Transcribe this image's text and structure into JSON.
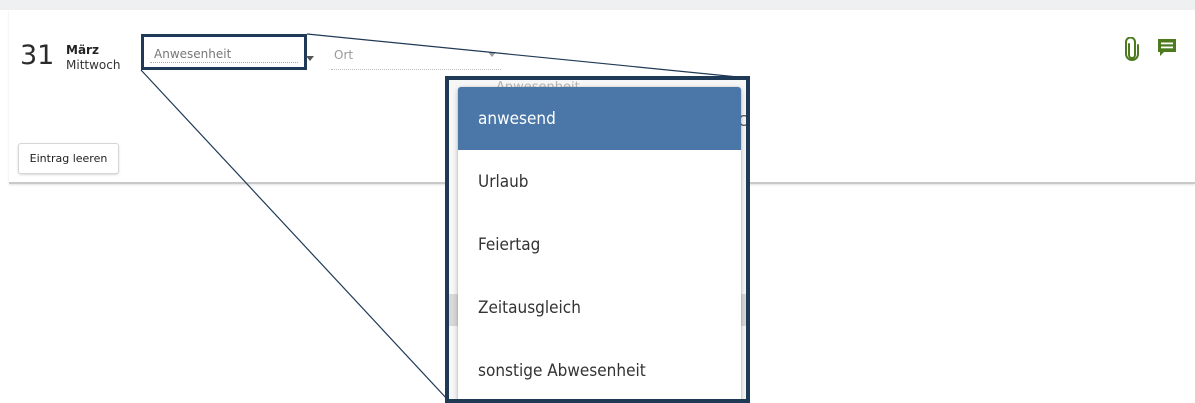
{
  "entry": {
    "day": "31",
    "month": "März",
    "weekday": "Mittwoch"
  },
  "fields": {
    "attendance_value": "Anwesenheit",
    "location_placeholder": "Ort"
  },
  "buttons": {
    "clear_entry": "Eintrag leeren"
  },
  "icons": {
    "attachment": "paperclip-icon",
    "comment": "comment-icon",
    "accent_color": "#4d7a1f"
  },
  "zoom": {
    "ghost_label": "Anwesenheit",
    "ghost_letter": "O"
  },
  "dropdown": {
    "selected_color": "#4a77a8",
    "frame_color": "#1e3a56",
    "options": [
      {
        "label": "anwesend"
      },
      {
        "label": "Urlaub"
      },
      {
        "label": "Feiertag"
      },
      {
        "label": "Zeitausgleich"
      },
      {
        "label": "sonstige Abwesenheit"
      }
    ]
  }
}
